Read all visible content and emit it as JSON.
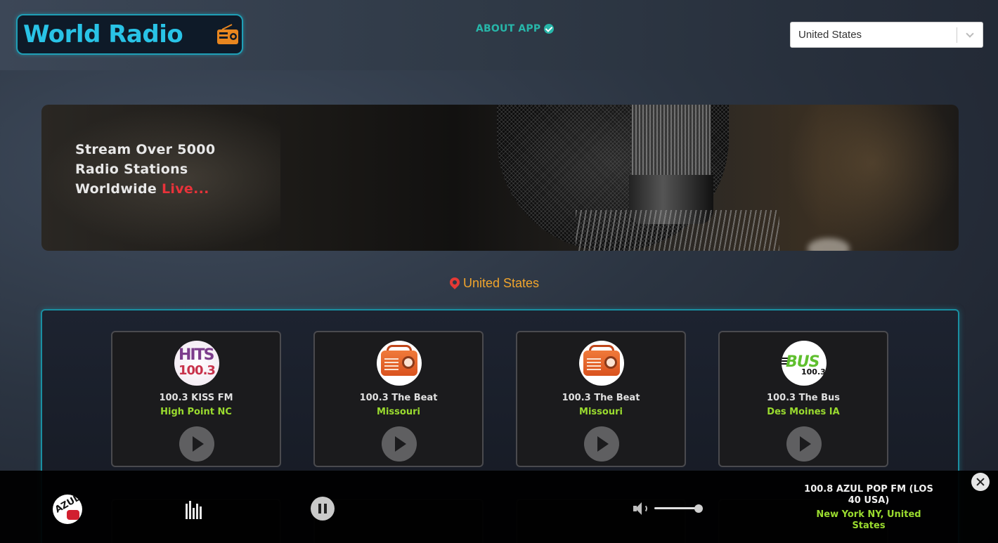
{
  "header": {
    "logo_text": "World Radio",
    "about_label": "ABOUT APP",
    "country_select_value": "United States"
  },
  "banner": {
    "line1": "Stream Over 5000",
    "line2": "Radio Stations",
    "line3_prefix": "Worldwide ",
    "line3_highlight": "Live..."
  },
  "location": {
    "country": "United States"
  },
  "stations": [
    {
      "name": "100.3 KISS FM",
      "location": "High Point NC",
      "logo": "hits-100-3-logo",
      "logo_text_top": "HITS",
      "logo_text_bottom": "100.3"
    },
    {
      "name": "100.3 The Beat",
      "location": "Missouri",
      "logo": "radio-icon"
    },
    {
      "name": "100.3 The Beat",
      "location": "Missouri",
      "logo": "radio-icon"
    },
    {
      "name": "100.3 The Bus",
      "location": "Des Moines IA",
      "logo": "the-bus-logo",
      "logo_text_top": "BUS",
      "logo_text_bottom": "100.3"
    }
  ],
  "player": {
    "now_playing_title": "100.8 AZUL POP FM (LOS 40 USA)",
    "now_playing_location": "New York NY, United States",
    "avatar_text": "AZUL",
    "volume_level": 0.92
  },
  "colors": {
    "accent_teal": "#27b6a9",
    "location_orange": "#f1a52c",
    "live_red": "#e8323a",
    "station_location_green": "#9adb2f",
    "panel_border": "#1a8fa2"
  }
}
